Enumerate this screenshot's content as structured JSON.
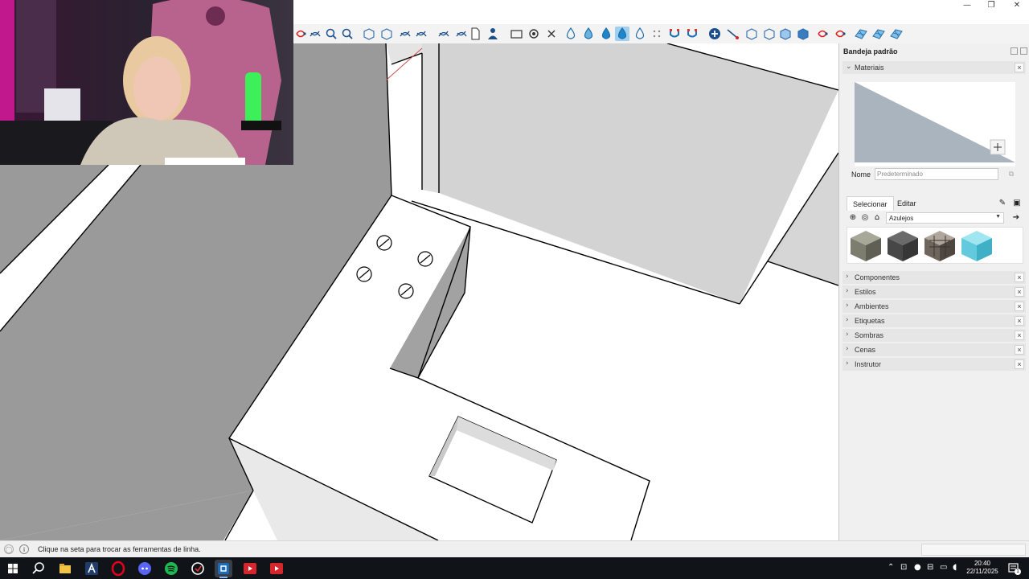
{
  "window": {
    "minimize": "—",
    "maximize": "❐",
    "close": "✕"
  },
  "toolbar": {
    "buttons": [
      "erase-red-icon",
      "follow-me-icon",
      "zoom-icon",
      "zoom-extents-icon",
      "sandbox-from-contours-icon",
      "sandbox-from-scratch-icon",
      "smoove-icon",
      "stamp-icon",
      "drape-icon",
      "walk-icon",
      "new-file-icon",
      "person-icon",
      "section-plane-icon",
      "gear-icon",
      "close-x-icon",
      "drop-outline-icon",
      "drop-half-icon",
      "drop-full-icon",
      "drop-active-icon",
      "drop-crossed-icon",
      "dots-icon",
      "magnet-icon",
      "magnet-active-icon",
      "add-point-icon",
      "line-node-icon",
      "box-outline-icon",
      "box-cloud-icon",
      "box-filled-icon",
      "box-solid-icon",
      "axis-red-icon",
      "rotate-red-icon",
      "grid-blue-icon",
      "grid-blue-2-icon",
      "grid-blue-3-icon"
    ],
    "active_index": 18
  },
  "tray": {
    "title": "Bandeja padrão",
    "materials": {
      "title": "Materiais",
      "name_label": "Nome",
      "name_value": "Predeterminado",
      "tab_select": "Selecionar",
      "tab_edit": "Editar",
      "library": "Azulejos",
      "swatch_colors": [
        "#8a8a7c",
        "#4b4b4b",
        "#7a726b",
        "#6fd3e6"
      ]
    },
    "panels": [
      "Componentes",
      "Estilos",
      "Ambientes",
      "Etiquetas",
      "Sombras",
      "Cenas",
      "Instrutor"
    ]
  },
  "status": {
    "text": "Clique na seta para trocar as ferramentas de linha."
  },
  "taskbar": {
    "time": "20:40",
    "date": "22/11/2025",
    "notification_count": "1",
    "colors": {
      "accent": "#7fb7ff",
      "spotify": "#1db954",
      "opera": "#e0001b",
      "sketchup": "#1a6bb8"
    }
  }
}
